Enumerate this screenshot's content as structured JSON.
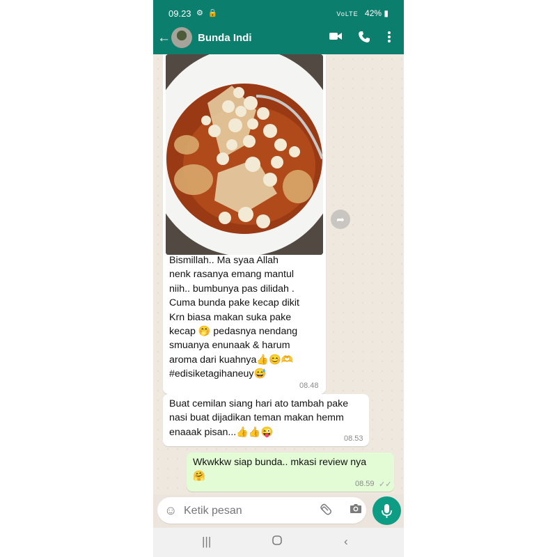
{
  "status_bar": {
    "time": "09.23",
    "left_icons": "⚙ 🔒",
    "signal": "VoLTE",
    "battery": "42%"
  },
  "header": {
    "contact_name": "Bunda Indi",
    "icons": [
      "back-arrow-icon",
      "video-call-icon",
      "phone-call-icon",
      "more-vertical-icon"
    ]
  },
  "messages": [
    {
      "direction": "incoming",
      "has_image": true,
      "image_subject": "bowl of seblak with crackers, dumpling skins and spicy broth",
      "text": "Bismillah..  Ma syaa Allah\nnenk rasanya emang mantul\nniih.. bumbunya pas dilidah .\nCuma bunda pake kecap dikit\nKrn biasa makan suka pake\nkecap 🤭 pedasnya nendang\nsmuanya enunaak & harum\naroma dari kuahnya👍😊🫶\n#edisiketagihaneuy😅",
      "time": "08.48"
    },
    {
      "direction": "incoming",
      "has_image": false,
      "text": "Buat cemilan siang hari ato tambah pake\nnasi buat dijadikan teman  makan hemm\nenaaak pisan...👍👍😜",
      "time": "08.53"
    },
    {
      "direction": "outgoing",
      "has_image": false,
      "text": "Wkwkkw siap bunda.. mkasi review nya\n🤗",
      "time": "08.59",
      "ticks": "✓✓"
    }
  ],
  "composer": {
    "placeholder": "Ketik pesan"
  },
  "colors": {
    "header": "#0b7e6d",
    "outgoing_bubble": "#e3fcd5",
    "mic_button": "#0d9d85"
  }
}
